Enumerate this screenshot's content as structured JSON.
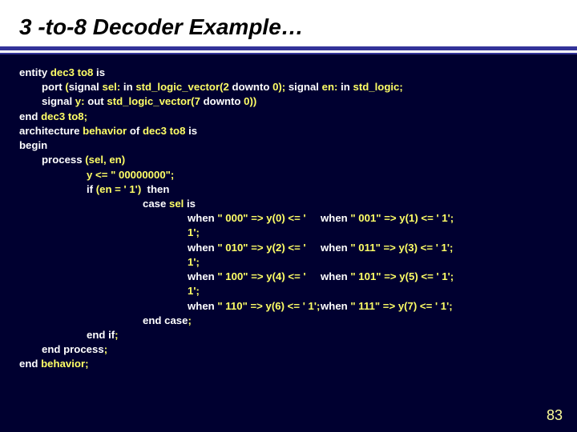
{
  "title": "3 -to-8 Decoder Example…",
  "pagenum": "83",
  "kw": {
    "entity": "entity",
    "is": "is",
    "port": "port",
    "signal": "signal",
    "in": "in",
    "downto": "downto",
    "out": "out",
    "end": "end",
    "architecture": "architecture",
    "of": "of",
    "begin": "begin",
    "process": "process",
    "if": "if",
    "then": "then",
    "case": "case",
    "when": "when",
    "endcase": "end case",
    "endif": "end if",
    "endprocess": "end process"
  },
  "id": {
    "dec3to8": "dec3 to8",
    "behavior": "behavior",
    "sel": "sel",
    "en": "en",
    "y": "y",
    "sel_en": "(sel, en)"
  },
  "txt": {
    "portopen": "(",
    "stdlv2": "std_logic_vector(2 ",
    "zeroparen_semi": "0); ",
    "stdl_semi": "std_logic;",
    "colon_sp": ": ",
    "stdlv7": "std_logic_vector(7 ",
    "zero_close": "0))",
    "dec_semi": "dec3 to8;",
    "yreset": "y <= \" 00000000\";",
    "en_eq": "(en = ' 1')  ",
    "sel_sp": "sel ",
    "w000": "\" 000\" => y(0) <= ' 1';",
    "w001": "\" 001\" => y(1) <= ' 1';",
    "w010": "\" 010\" => y(2) <= ' 1';",
    "w011": "\" 011\" => y(3) <= ' 1';",
    "w100": "\" 100\" => y(4) <= ' 1';",
    "w101": "\" 101\" => y(5) <= ' 1';",
    "w110": "\" 110\" => y(6) <= ' 1';",
    "w111": "\" 111\" => y(7) <= ' 1';",
    "beh_semi": "behavior;",
    "semi": ";"
  }
}
